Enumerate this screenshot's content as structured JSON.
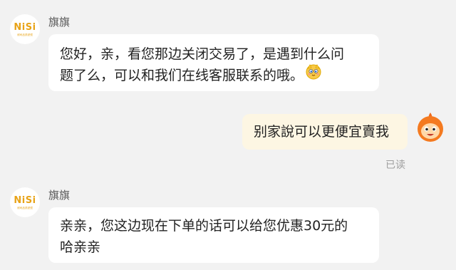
{
  "conversation": {
    "messages": [
      {
        "sender": "旗旗",
        "avatar_logo": "NiSi",
        "avatar_logo_sub": "耐司品质滤镜",
        "lines": [
          "您好，亲，看您那边关闭交易了，是遇到什么问",
          "题了么，可以和我们在线客服联系的哦。"
        ],
        "emoji": "cute-face-emoji"
      },
      {
        "sender": "me",
        "text": "别家說可以更便宜賣我",
        "status": "已读",
        "avatar_icon": "cartoon-mascot-icon"
      },
      {
        "sender": "旗旗",
        "avatar_logo": "NiSi",
        "avatar_logo_sub": "耐司品质滤镜",
        "lines": [
          "亲亲，您这边现在下单的话可以给您优惠30元的",
          "哈亲亲"
        ]
      }
    ]
  },
  "colors": {
    "background": "#f2f2f2",
    "bubble_left": "#ffffff",
    "bubble_right": "#fdf6e3",
    "logo": "#e8a317",
    "read_status": "#9e9e9e"
  }
}
